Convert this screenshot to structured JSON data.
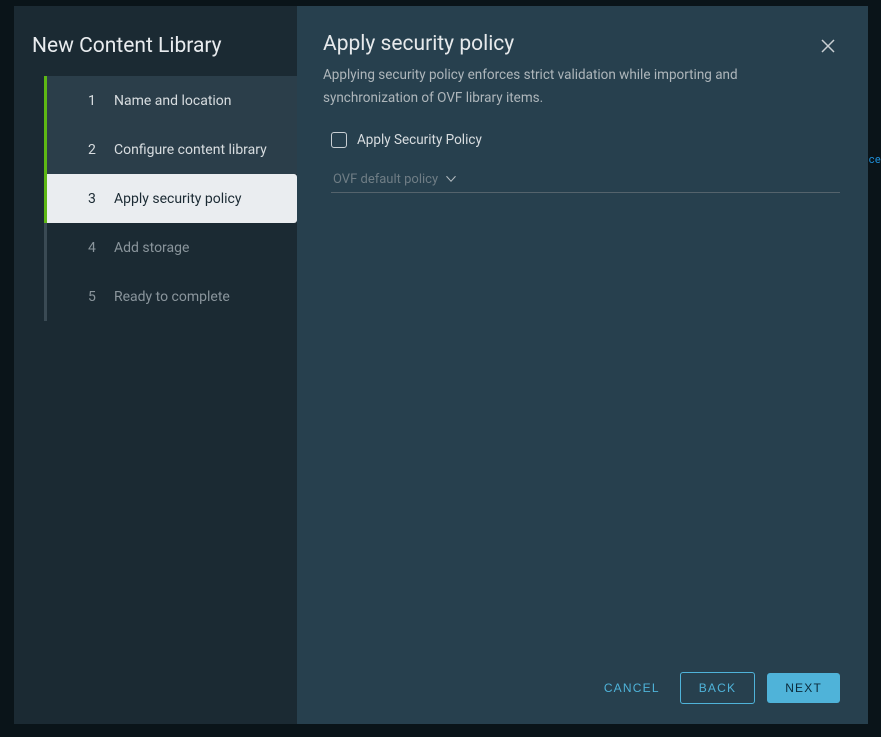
{
  "sidebar": {
    "title": "New Content Library",
    "steps": [
      {
        "num": "1",
        "label": "Name and location",
        "state": "completed"
      },
      {
        "num": "2",
        "label": "Configure content library",
        "state": "completed"
      },
      {
        "num": "3",
        "label": "Apply security policy",
        "state": "active"
      },
      {
        "num": "4",
        "label": "Add storage",
        "state": "upcoming"
      },
      {
        "num": "5",
        "label": "Ready to complete",
        "state": "upcoming"
      }
    ]
  },
  "panel": {
    "title": "Apply security policy",
    "description": "Applying security policy enforces strict validation while importing and synchronization of OVF library items.",
    "checkbox_label": "Apply Security Policy",
    "checkbox_checked": false,
    "dropdown_value": "OVF default policy",
    "dropdown_enabled": false
  },
  "footer": {
    "cancel_label": "CANCEL",
    "back_label": "BACK",
    "next_label": "NEXT"
  },
  "background_hint": "ce"
}
